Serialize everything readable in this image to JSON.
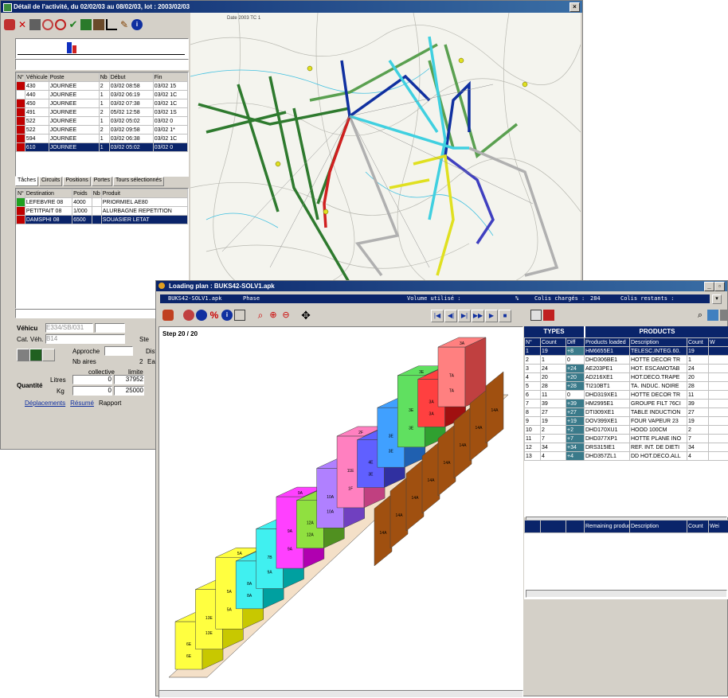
{
  "colors": {
    "titlebar": "#0a246a",
    "selection": "#0a246a",
    "types_header": "#0a246a",
    "window_bg": "#d4d0c8",
    "map_bg": "#f4f4ee"
  },
  "back_window": {
    "title": "Détail de l'activité, du 02/02/03 au 08/02/03, lot : 2003/02/03",
    "map_label": "Date 2003 TC 1",
    "columns": [
      "N°",
      "Véhicule",
      "Poste",
      "Nb",
      "Début",
      "Fin"
    ],
    "rows": [
      {
        "veh": "430",
        "poste": "JOURNEE",
        "nb": "2",
        "debut": "03/02 08:58",
        "fin": "03/02 15"
      },
      {
        "veh": "440",
        "poste": "JOURNEE",
        "nb": "1",
        "debut": "03/02 06:19",
        "fin": "03/02 1C"
      },
      {
        "veh": "450",
        "poste": "JOURNEE",
        "nb": "1",
        "debut": "03/02 07:38",
        "fin": "03/02 1C"
      },
      {
        "veh": "491",
        "poste": "JOURNEE",
        "nb": "2",
        "debut": "05/02 12:58",
        "fin": "03/02 1S"
      },
      {
        "veh": "522",
        "poste": "JOURNEE",
        "nb": "1",
        "debut": "03/02 05:02",
        "fin": "03/02 0"
      },
      {
        "veh": "522",
        "poste": "JOURNEE",
        "nb": "2",
        "debut": "03/02 09:58",
        "fin": "03/02 1*"
      },
      {
        "veh": "594",
        "poste": "JOURNEE",
        "nb": "1",
        "debut": "03/02 06:38",
        "fin": "03/02 1C"
      },
      {
        "veh": "610",
        "poste": "JOURNEE",
        "nb": "1",
        "debut": "03/02 05:02",
        "fin": "03/02 0"
      }
    ],
    "tabs": [
      "Tâches",
      "Circuits",
      "Positions",
      "Portes",
      "Tours sélectionnés"
    ],
    "dest_columns": [
      "N°",
      "Destination",
      "Poids",
      "Nb",
      "Produit"
    ],
    "destinations": [
      {
        "dest": "LEFEBVRE 08",
        "poids": "4000",
        "produit": "PRIORMIEL AE80"
      },
      {
        "dest": "PETITPAIT 08",
        "poids": "1/000",
        "produit": "ALURBAGNE REPETITION"
      },
      {
        "dest": "DAMSPHI 08",
        "poids": "6500",
        "produit": "SOUASIER LETAT"
      }
    ],
    "form": {
      "vehicule_label": "Véhicu",
      "vehicule_value": "E334/SB/031",
      "cat_label": "Cat. Véh.",
      "cat_value": "B14",
      "approche_label": "Approche",
      "nb_aires_label": "Nb aires",
      "nb_aires_value": "2",
      "quantite_label": "Quantité",
      "collective_label": "collective",
      "limite_label": "limite",
      "litres_label": "Litres",
      "litres_collective": "0",
      "litres_limite": "37952",
      "kg_label": "Kg",
      "kg_collective": "0",
      "kg_limite": "25000",
      "right_labels": [
        "Ste",
        "Dist",
        "Ean"
      ]
    },
    "bottom_tabs": [
      "Déplacements",
      "Résumé",
      "Rapport"
    ]
  },
  "front_window": {
    "title": "Loading plan : BUKS42-SOLV1.apk",
    "status": {
      "file": "BUKS42-SOLV1.apk",
      "phase": "Phase",
      "volume": "Volume utilisé :",
      "percent": "%",
      "colis_charges": "Colis chargés :",
      "colis_charges_value": "284",
      "colis_restants": "Colis restants :"
    },
    "step_label": "Step 20 / 20",
    "types_header": "TYPES",
    "products_header": "PRODUCTS",
    "columns": [
      "N°",
      "Count",
      "Diff",
      "Products loaded",
      "Description",
      "Count",
      "W"
    ],
    "rows": [
      {
        "n": "1",
        "count": "19",
        "diff": "+8",
        "code": "HM6655E1",
        "desc": "TELESC.INTEG.60.",
        "count2": "19"
      },
      {
        "n": "2",
        "count": "1",
        "diff": "0",
        "code": "DHD306BE1",
        "desc": "HOTTE DECOR TR",
        "count2": "1"
      },
      {
        "n": "3",
        "count": "24",
        "diff": "+24",
        "code": "AE203PE1",
        "desc": "HOT. ESCAMOTAB",
        "count2": "24"
      },
      {
        "n": "4",
        "count": "20",
        "diff": "+20",
        "code": "AD216XE1",
        "desc": "HOT.DECO.TRAPE",
        "count2": "20"
      },
      {
        "n": "5",
        "count": "28",
        "diff": "+28",
        "code": "TI210BT1",
        "desc": "TA. INDUC. NOIRE",
        "count2": "28"
      },
      {
        "n": "6",
        "count": "11",
        "diff": "0",
        "code": "DHD319XE1",
        "desc": "HOTTE DECOR TR",
        "count2": "11"
      },
      {
        "n": "7",
        "count": "39",
        "diff": "+39",
        "code": "HM2995E1",
        "desc": "GROUPE FILT 76CI",
        "count2": "39"
      },
      {
        "n": "8",
        "count": "27",
        "diff": "+27",
        "code": "DTI309XE1",
        "desc": "TABLE INDUCTION",
        "count2": "27"
      },
      {
        "n": "9",
        "count": "19",
        "diff": "+19",
        "code": "DOV399XE1",
        "desc": "FOUR VAPEUR 23",
        "count2": "19"
      },
      {
        "n": "10",
        "count": "2",
        "diff": "+2",
        "code": "DHD170XU1",
        "desc": "HOOD 100CM",
        "count2": "2"
      },
      {
        "n": "11",
        "count": "7",
        "diff": "+7",
        "code": "DHD377XP1",
        "desc": "HOTTE PLANE INO",
        "count2": "7"
      },
      {
        "n": "12",
        "count": "34",
        "diff": "+34",
        "code": "DRS315IE1",
        "desc": "REF. INT. DE DIETI",
        "count2": "34"
      },
      {
        "n": "13",
        "count": "4",
        "diff": "+4",
        "code": "DHD357ZL1",
        "desc": "DD HOT.DECO.ALL",
        "count2": "4"
      }
    ],
    "remaining_columns": [
      "",
      "",
      "",
      "Remaining produc",
      "Description",
      "Count",
      "Wei"
    ],
    "box_labels": {
      "top": [
        "6E",
        "6E",
        "6E",
        "1F",
        "13E",
        "13E",
        "5A",
        "5A",
        "5A",
        "7B",
        "8A",
        "8A",
        "8A",
        "7B",
        "9A",
        "9A",
        "9A",
        "9A",
        "11A",
        "12A",
        "12A",
        "12A",
        "10A",
        "10A",
        "2F",
        "11E",
        "1F",
        "4E",
        "4E",
        "3E",
        "3B",
        "3E",
        "3E",
        "3E",
        "3E",
        "3E",
        "3A",
        "3A",
        "3A",
        "3A",
        "TA",
        "TA",
        "14A",
        "14A"
      ]
    }
  }
}
